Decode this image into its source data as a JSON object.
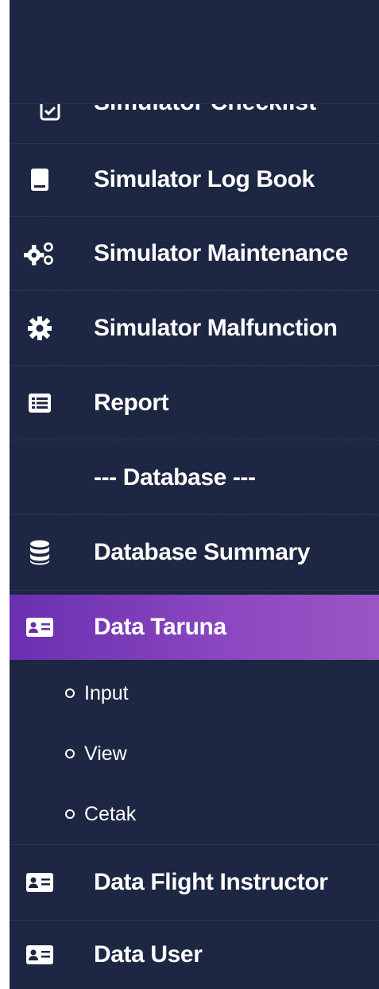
{
  "sidebar": {
    "items": [
      {
        "label": "Simulator Checklist",
        "icon": "checklist-icon"
      },
      {
        "label": "Simulator Log Book",
        "icon": "book-icon"
      },
      {
        "label": "Simulator Maintenance",
        "icon": "cogs-icon"
      },
      {
        "label": "Simulator Malfunction",
        "icon": "gear-icon"
      },
      {
        "label": "Report",
        "icon": "list-icon"
      },
      {
        "label": "--- Database ---"
      },
      {
        "label": "Database Summary",
        "icon": "database-icon"
      },
      {
        "label": "Data Taruna",
        "icon": "id-card-icon",
        "active": true
      },
      {
        "label": "Data Flight Instructor",
        "icon": "id-card-icon"
      },
      {
        "label": "Data User",
        "icon": "id-card-icon"
      }
    ],
    "submenu": [
      {
        "label": "Input"
      },
      {
        "label": "View"
      },
      {
        "label": "Cetak"
      }
    ]
  },
  "colors": {
    "sidebar_bg": "#1d2642",
    "active_gradient_start": "#6a2fb0",
    "active_gradient_end": "#9a55c4",
    "text": "#ffffff"
  }
}
